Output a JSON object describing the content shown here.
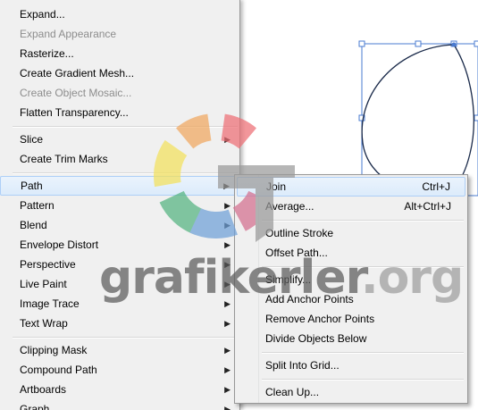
{
  "menu": {
    "items": [
      {
        "label": "Expand...",
        "disabled": false,
        "submenu": false
      },
      {
        "label": "Expand Appearance",
        "disabled": true,
        "submenu": false
      },
      {
        "label": "Rasterize...",
        "disabled": false,
        "submenu": false
      },
      {
        "label": "Create Gradient Mesh...",
        "disabled": false,
        "submenu": false
      },
      {
        "label": "Create Object Mosaic...",
        "disabled": true,
        "submenu": false
      },
      {
        "label": "Flatten Transparency...",
        "disabled": false,
        "submenu": false
      },
      {
        "label": "Slice",
        "disabled": false,
        "submenu": true
      },
      {
        "label": "Create Trim Marks",
        "disabled": false,
        "submenu": false
      },
      {
        "label": "Path",
        "disabled": false,
        "submenu": true,
        "active": true
      },
      {
        "label": "Pattern",
        "disabled": false,
        "submenu": true
      },
      {
        "label": "Blend",
        "disabled": false,
        "submenu": true
      },
      {
        "label": "Envelope Distort",
        "disabled": false,
        "submenu": true
      },
      {
        "label": "Perspective",
        "disabled": false,
        "submenu": true
      },
      {
        "label": "Live Paint",
        "disabled": false,
        "submenu": true
      },
      {
        "label": "Image Trace",
        "disabled": false,
        "submenu": true
      },
      {
        "label": "Text Wrap",
        "disabled": false,
        "submenu": true
      },
      {
        "label": "Clipping Mask",
        "disabled": false,
        "submenu": true
      },
      {
        "label": "Compound Path",
        "disabled": false,
        "submenu": true
      },
      {
        "label": "Artboards",
        "disabled": false,
        "submenu": true
      },
      {
        "label": "Graph",
        "disabled": false,
        "submenu": true
      }
    ]
  },
  "path_submenu": {
    "items": [
      {
        "label": "Join",
        "shortcut": "Ctrl+J",
        "active": true
      },
      {
        "label": "Average...",
        "shortcut": "Alt+Ctrl+J"
      },
      {
        "label": "Outline Stroke",
        "shortcut": ""
      },
      {
        "label": "Offset Path...",
        "shortcut": ""
      },
      {
        "label": "Simplify...",
        "shortcut": ""
      },
      {
        "label": "Add Anchor Points",
        "shortcut": ""
      },
      {
        "label": "Remove Anchor Points",
        "shortcut": ""
      },
      {
        "label": "Divide Objects Below",
        "shortcut": ""
      },
      {
        "label": "Split Into Grid...",
        "shortcut": ""
      },
      {
        "label": "Clean Up...",
        "shortcut": ""
      }
    ]
  },
  "watermark": {
    "text": "grafikerler",
    "suffix": ".org",
    "colors": [
      "#f0a860",
      "#ee6f75",
      "#f3e15c",
      "#54b480",
      "#6fa0d8",
      "#d46f8e",
      "#9a9a9a"
    ]
  },
  "selection_color": "#4a7bd0"
}
